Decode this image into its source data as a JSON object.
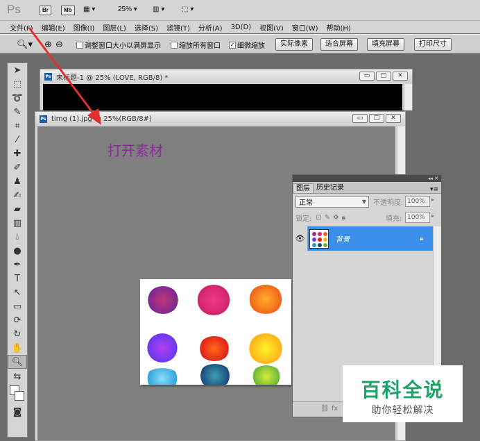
{
  "app": {
    "logo": "Ps",
    "bridge": "Br",
    "minibridge": "Mb",
    "zoom": "25%"
  },
  "menu": [
    "文件(F)",
    "编辑(E)",
    "图像(I)",
    "图层(L)",
    "选择(S)",
    "滤镜(T)",
    "分析(A)",
    "3D(D)",
    "视图(V)",
    "窗口(W)",
    "帮助(H)"
  ],
  "options": {
    "resize_windows": "调整窗口大小以满屏显示",
    "zoom_all": "缩放所有窗口",
    "scrubby_zoom": "细微缩放",
    "actual_pixels": "实际像素",
    "fit_screen": "适合屏幕",
    "fill_screen": "填充屏幕",
    "print_size": "打印尺寸"
  },
  "doc_back": {
    "title": "未标题-1 @ 25% (LOVE, RGB/8) *"
  },
  "doc_front": {
    "title": "timg (1).jpg @ 25%(RGB/8#)"
  },
  "annotation": "打开素材",
  "layers_panel": {
    "tab_layers": "图层",
    "tab_history": "历史记录",
    "blend_mode": "正常",
    "opacity_label": "不透明度:",
    "opacity_value": "100%",
    "lock_label": "锁定:",
    "fill_label": "填充:",
    "fill_value": "100%",
    "layer_name": "背景"
  },
  "watermark": {
    "title": "百科全说",
    "subtitle": "助你轻松解决"
  },
  "colors": {
    "accent_layer": "#3b8fea",
    "arrow": "#e03030",
    "annotation_text": "#8e2a9e",
    "watermark_green": "#1aa46a"
  }
}
